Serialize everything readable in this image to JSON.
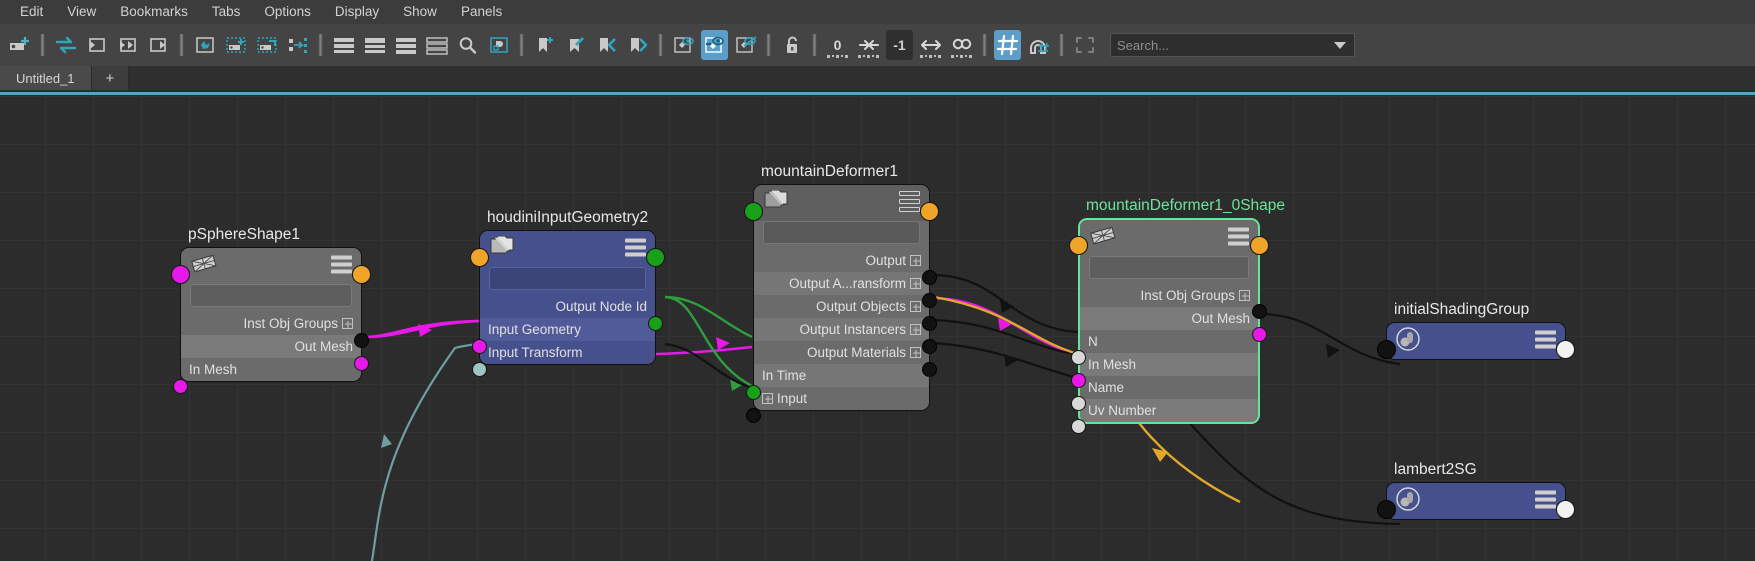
{
  "menubar": {
    "items": [
      {
        "label": "Edit"
      },
      {
        "label": "View"
      },
      {
        "label": "Bookmarks"
      },
      {
        "label": "Tabs"
      },
      {
        "label": "Options"
      },
      {
        "label": "Display"
      },
      {
        "label": "Show"
      },
      {
        "label": "Panels"
      }
    ]
  },
  "toolbar": {
    "frame_all_value": "0",
    "frame_negative_value": "-1",
    "search": {
      "placeholder": "Search..."
    },
    "icons": [
      "add-node-icon",
      "swap-icon",
      "input-connection-icon",
      "both-connections-icon",
      "output-connection-icon",
      "rearrange-graph-icon",
      "add-to-graph-icon",
      "remove-from-graph-icon",
      "shift-nodes-icon",
      "layout-horizontal-icon",
      "layout-vertical-icon",
      "layout-grid-icon",
      "layout-list-icon",
      "search-icon",
      "overlay-icon",
      "bookmark-add-icon",
      "bookmark-edit-icon",
      "bookmark-prev-icon",
      "bookmark-next-icon",
      "show-upstream-icon",
      "show-selected-icon",
      "hide-icon",
      "unlock-icon",
      "zero-depth-icon",
      "collapse-icon",
      "negative-depth-icon",
      "expand-horizontal-icon",
      "infinite-depth-icon",
      "grid-icon",
      "snap-magnet-icon",
      "frame-selection-icon",
      "search-dropdown-icon"
    ]
  },
  "tabs": {
    "items": [
      {
        "label": "Untitled_1"
      },
      {
        "label": "+"
      }
    ]
  },
  "graph": {
    "nodes": [
      {
        "id": "pSphereShape1",
        "title": "pSphereShape1",
        "icon": "mesh-icon",
        "selected": false,
        "style": "gray",
        "attrs": [
          {
            "label": "Inst Obj Groups",
            "side": "out",
            "expandable": true,
            "port": "black"
          },
          {
            "label": "Out Mesh",
            "side": "out",
            "expandable": false,
            "port": "magenta",
            "alt": true
          },
          {
            "label": "In Mesh",
            "side": "in",
            "expandable": false,
            "port": "magenta"
          }
        ]
      },
      {
        "id": "houdiniInputGeometry2",
        "title": "houdiniInputGeometry2",
        "icon": "layers-icon",
        "selected": false,
        "style": "blue",
        "attrs": [
          {
            "label": "Output Node Id",
            "side": "out",
            "expandable": false,
            "port": "green"
          },
          {
            "label": "Input Geometry",
            "side": "in",
            "expandable": false,
            "port": "magenta",
            "alt": true
          },
          {
            "label": "Input Transform",
            "side": "in",
            "expandable": false,
            "port": "lightblue"
          }
        ]
      },
      {
        "id": "mountainDeformer1",
        "title": "mountainDeformer1",
        "icon": "layers-icon",
        "selected": false,
        "style": "darkgray",
        "attrs": [
          {
            "label": "Output",
            "side": "out",
            "expandable": false,
            "port": "black"
          },
          {
            "label": "Output A...ransform",
            "side": "out",
            "expandable": true,
            "port": "black",
            "alt": true
          },
          {
            "label": "Output Objects",
            "side": "out",
            "expandable": true,
            "port": "black"
          },
          {
            "label": "Output Instancers",
            "side": "out",
            "expandable": true,
            "port": "black",
            "alt": true
          },
          {
            "label": "Output Materials",
            "side": "out",
            "expandable": true,
            "port": "black"
          },
          {
            "label": "In Time",
            "side": "in",
            "expandable": false,
            "port": "green",
            "alt": true
          },
          {
            "label": "Input",
            "side": "in",
            "expandable": true,
            "port": "black"
          }
        ]
      },
      {
        "id": "mountainDeformer1_0Shape",
        "title": "mountainDeformer1_0Shape",
        "icon": "mesh-icon",
        "selected": true,
        "style": "gray",
        "attrs": [
          {
            "label": "Inst Obj Groups",
            "side": "out",
            "expandable": true,
            "port": "black"
          },
          {
            "label": "Out Mesh",
            "side": "out",
            "expandable": false,
            "port": "magenta",
            "alt": true
          },
          {
            "label": "N",
            "side": "in",
            "expandable": false,
            "port": "white"
          },
          {
            "label": "In Mesh",
            "side": "in",
            "expandable": false,
            "port": "magenta",
            "alt": true
          },
          {
            "label": "Name",
            "side": "in",
            "expandable": false,
            "port": "white"
          },
          {
            "label": "Uv Number",
            "side": "in",
            "expandable": false,
            "port": "white",
            "alt": true
          }
        ]
      },
      {
        "id": "initialShadingGroup",
        "title": "initialShadingGroup",
        "icon": "shading-group-icon",
        "selected": false,
        "style": "blue",
        "attrs": []
      },
      {
        "id": "lambert2SG",
        "title": "lambert2SG",
        "icon": "shading-group-icon",
        "selected": false,
        "style": "blue",
        "attrs": []
      }
    ]
  },
  "colors": {
    "accent": "#5a9ec9",
    "selected_node_outline": "#63e59a",
    "magenta_port": "#e818e8",
    "orange_port": "#f0a52a",
    "green_port": "#18a018",
    "white_port": "#d8d8d8",
    "wire_black": "#111111",
    "wire_magenta": "#e818e8",
    "wire_green": "#2e9e3e",
    "wire_orange": "#e0a72c",
    "wire_teal": "#6f9e9e"
  }
}
